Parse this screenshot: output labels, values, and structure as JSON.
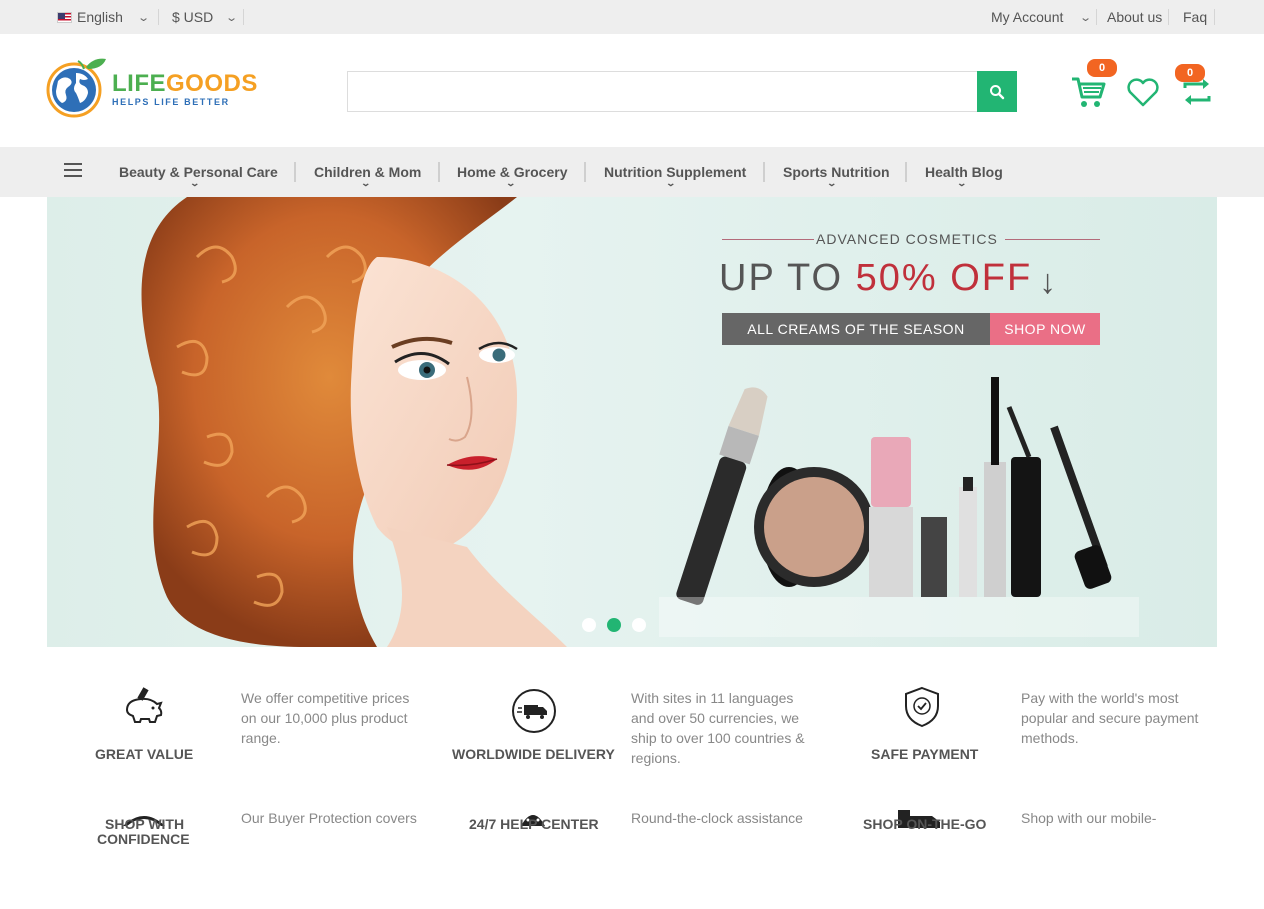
{
  "topbar": {
    "language": "English",
    "currency": "$ USD",
    "my_account": "My Account",
    "about_us": "About us",
    "faq": "Faq"
  },
  "logo": {
    "name_part1": "LIFE",
    "name_part2": "GOODS",
    "tagline": "HELPS LIFE BETTER"
  },
  "search": {
    "placeholder": "",
    "value": ""
  },
  "header": {
    "cart_count": "0",
    "compare_count": "0"
  },
  "nav": {
    "items": [
      {
        "label": "Beauty & Personal Care"
      },
      {
        "label": "Children & Mom"
      },
      {
        "label": "Home & Grocery"
      },
      {
        "label": "Nutrition Supplement"
      },
      {
        "label": "Sports Nutrition"
      },
      {
        "label": "Health Blog"
      }
    ]
  },
  "hero": {
    "subtitle": "ADVANCED COSMETICS",
    "title_prefix": "UP TO ",
    "title_highlight": "50% OFF",
    "promo": "ALL CREAMS OF THE SEASON",
    "cta": "SHOP NOW",
    "active_slide": 2,
    "slide_count": 3
  },
  "features": [
    {
      "title": "GREAT VALUE",
      "desc": "We offer competitive prices on our 10,000 plus product range.",
      "icon": "piggy-bank-icon"
    },
    {
      "title": "WORLDWIDE DELIVERY",
      "desc": "With sites in 11 languages and over 50 currencies, we ship to over 100 countries & regions.",
      "icon": "delivery-truck-icon"
    },
    {
      "title": "SAFE PAYMENT",
      "desc": "Pay with the world's most popular and secure payment methods.",
      "icon": "shield-check-icon"
    },
    {
      "title_line1": "SHOP WITH",
      "title_line2": "CONFIDENCE",
      "desc": "Our Buyer Protection covers",
      "icon": "umbrella-icon"
    },
    {
      "title": "24/7 HELP CENTER",
      "desc": "Round-the-clock assistance",
      "icon": "headset-icon"
    },
    {
      "title": "SHOP ON-THE-GO",
      "desc": "Shop with our mobile-",
      "icon": "mobile-icon"
    }
  ],
  "colors": {
    "accent_green": "#22b573",
    "badge_orange": "#f26522",
    "sale_red": "#c0303b",
    "cta_pink": "#ea6f86"
  }
}
